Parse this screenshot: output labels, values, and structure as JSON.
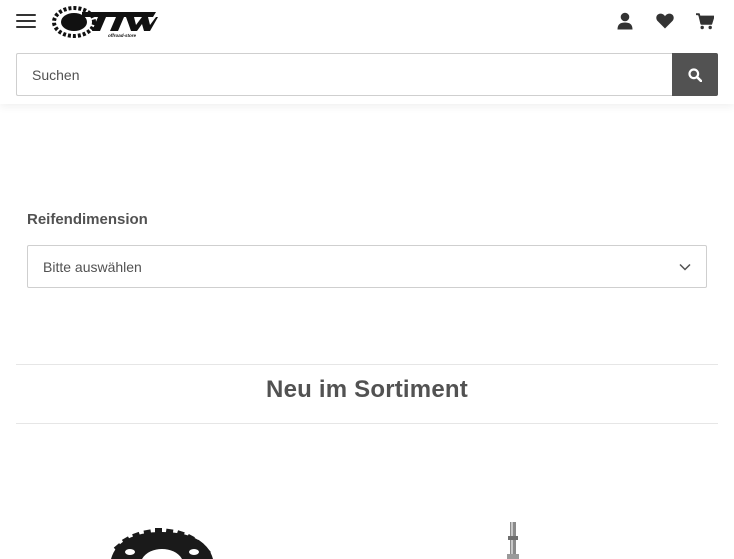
{
  "header": {
    "menu_icon": "hamburger-menu-icon",
    "logo_text": "TTW",
    "logo_tagline": "offroad-store",
    "icons": [
      "user-icon",
      "heart-icon",
      "cart-icon"
    ]
  },
  "search": {
    "placeholder": "Suchen",
    "value": "",
    "button_icon": "search-icon"
  },
  "filter": {
    "label": "Reifendimension",
    "selected": "Bitte auswählen"
  },
  "section": {
    "title": "Neu im Sortiment"
  },
  "products": [
    {
      "image": "sprocket-image"
    },
    {
      "image": "shock-absorber-image"
    }
  ],
  "colors": {
    "text": "#525252",
    "search_button": "#525252",
    "border": "#cfcfcf"
  }
}
